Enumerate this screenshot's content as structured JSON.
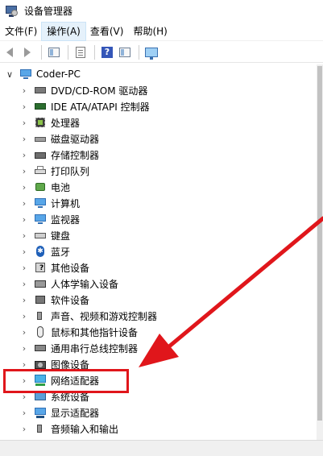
{
  "window": {
    "title": "设备管理器",
    "icon": "device-manager-icon"
  },
  "menu": [
    {
      "label": "文件(F)",
      "active": false
    },
    {
      "label": "操作(A)",
      "active": true
    },
    {
      "label": "查看(V)",
      "active": false
    },
    {
      "label": "帮助(H)",
      "active": false
    }
  ],
  "toolbar": {
    "buttons": [
      "back-arrow-icon",
      "forward-arrow-icon",
      "properties-icon",
      "list-icon",
      "help-icon",
      "view-icon",
      "scan-hardware-icon"
    ]
  },
  "tree": {
    "root": {
      "label": "Coder-PC",
      "expanded": true,
      "icon": "computer-icon"
    },
    "items": [
      {
        "label": "DVD/CD-ROM 驱动器",
        "icon": "dvd-drive-icon"
      },
      {
        "label": "IDE ATA/ATAPI 控制器",
        "icon": "ide-controller-icon"
      },
      {
        "label": "处理器",
        "icon": "processor-icon"
      },
      {
        "label": "磁盘驱动器",
        "icon": "disk-drive-icon"
      },
      {
        "label": "存储控制器",
        "icon": "storage-controller-icon"
      },
      {
        "label": "打印队列",
        "icon": "printer-icon"
      },
      {
        "label": "电池",
        "icon": "battery-icon"
      },
      {
        "label": "计算机",
        "icon": "computer-icon"
      },
      {
        "label": "监视器",
        "icon": "monitor-icon"
      },
      {
        "label": "键盘",
        "icon": "keyboard-icon"
      },
      {
        "label": "蓝牙",
        "icon": "bluetooth-icon"
      },
      {
        "label": "其他设备",
        "icon": "other-device-icon"
      },
      {
        "label": "人体学输入设备",
        "icon": "hid-icon"
      },
      {
        "label": "软件设备",
        "icon": "software-device-icon"
      },
      {
        "label": "声音、视频和游戏控制器",
        "icon": "speaker-icon"
      },
      {
        "label": "鼠标和其他指针设备",
        "icon": "mouse-icon"
      },
      {
        "label": "通用串行总线控制器",
        "icon": "usb-icon"
      },
      {
        "label": "图像设备",
        "icon": "camera-icon"
      },
      {
        "label": "网络适配器",
        "icon": "network-adapter-icon"
      },
      {
        "label": "系统设备",
        "icon": "system-device-icon"
      },
      {
        "label": "显示适配器",
        "icon": "display-adapter-icon"
      },
      {
        "label": "音频输入和输出",
        "icon": "audio-io-icon"
      }
    ]
  },
  "annotation": {
    "color": "#e0161b",
    "highlighted_item": "网络适配器"
  }
}
